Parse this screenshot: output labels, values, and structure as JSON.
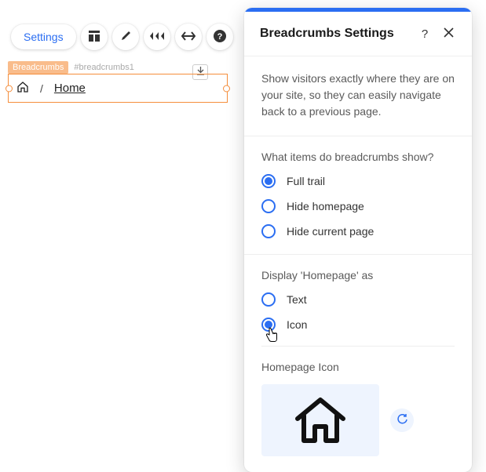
{
  "toolbar": {
    "settings_label": "Settings"
  },
  "element": {
    "tag_name": "Breadcrumbs",
    "element_id": "#breadcrumbs1"
  },
  "breadcrumb": {
    "separator": "/",
    "current": "Home"
  },
  "panel": {
    "title": "Breadcrumbs Settings",
    "description": "Show visitors exactly where they are on your site, so they can easily navigate back to a previous page.",
    "items_question": "What items do breadcrumbs show?",
    "items_options": {
      "full_trail": "Full trail",
      "hide_homepage": "Hide homepage",
      "hide_current": "Hide current page"
    },
    "display_question": "Display 'Homepage' as",
    "display_options": {
      "text": "Text",
      "icon": "Icon"
    },
    "homepage_icon_label": "Homepage Icon"
  }
}
